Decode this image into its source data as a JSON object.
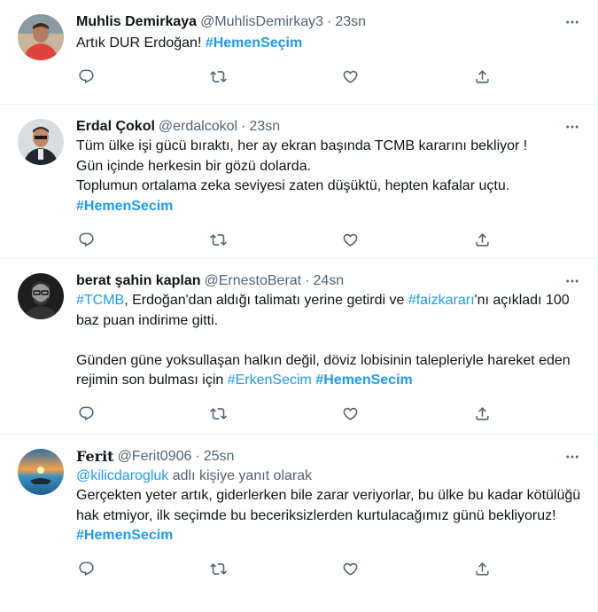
{
  "tweets": [
    {
      "name": "Muhlis Demirkaya",
      "handle": "@MuhlisDemirkay3",
      "dot": "·",
      "time": "23sn",
      "text": "Artık DUR Erdoğan! ",
      "tag1": "#HemenSeçim"
    },
    {
      "name": "Erdal Çokol",
      "handle": "@erdalcokol",
      "dot": "·",
      "time": "23sn",
      "line1": "Tüm ülke işi gücü bıraktı, her ay ekran başında TCMB kararını bekliyor !",
      "line2": "Gün içinde herkesin bir gözü dolarda.",
      "line3": "Toplumun ortalama zeka seviyesi zaten düşüktü, hepten kafalar uçtu.",
      "tag1": "#HemenSecim"
    },
    {
      "name": "berat şahin kaplan",
      "handle": "@ErnestoBerat",
      "dot": "·",
      "time": "24sn",
      "link1": "#TCMB",
      "text1": ", Erdoğan'dan aldığı talimatı yerine getirdi ve ",
      "link2": "#faizkararı",
      "text2": "'nı açıkladı 100 baz puan indirime gitti.",
      "text3": "Günden güne yoksullaşan halkın değil, döviz lobisinin talepleriyle hareket eden rejimin son bulması için ",
      "link3": "#ErkenSecim",
      "tag1": "#HemenSecim"
    },
    {
      "name": "Ferit",
      "handle": "@Ferit0906",
      "dot": "·",
      "time": "25sn",
      "reply_link": "@kilicdarogluk",
      "reply_text": " adlı kişiye yanıt olarak",
      "text": "Gerçekten yeter artık, giderlerken bile zarar veriyorlar, bu ülke bu kadar kötülüğü hak etmiyor, ilk seçimde bu beceriksizlerden kurtulacağımız günü bekliyoruz!",
      "tag1": "#HemenSecim"
    }
  ],
  "icons": {
    "more": "more-icon",
    "reply": "reply-icon",
    "retweet": "retweet-icon",
    "like": "like-icon",
    "share": "share-icon"
  },
  "colors": {
    "accent": "#1d9bf0",
    "secondary_text": "#536471",
    "border": "#eff3f4"
  }
}
